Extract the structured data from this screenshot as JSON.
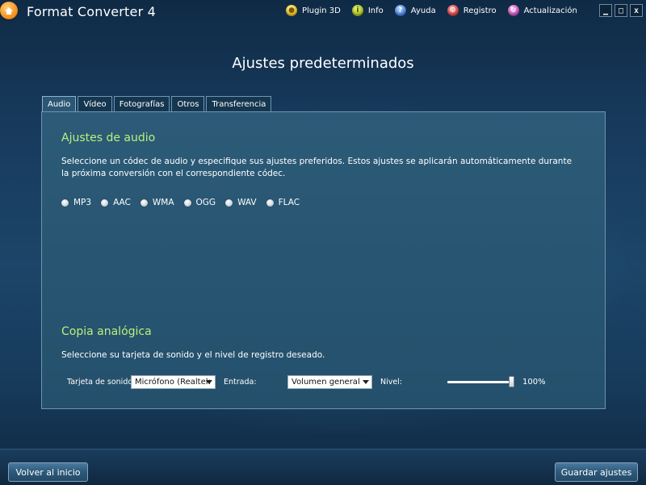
{
  "window": {
    "title": "Format Converter 4",
    "menu": [
      {
        "label": "Plugin 3D",
        "icon": "plugin-3d-icon"
      },
      {
        "label": "Info",
        "icon": "info-icon"
      },
      {
        "label": "Ayuda",
        "icon": "help-icon"
      },
      {
        "label": "Registro",
        "icon": "register-icon"
      },
      {
        "label": "Actualización",
        "icon": "update-icon"
      }
    ],
    "controls": {
      "minimize": "▁",
      "maximize": "□",
      "close": "x"
    }
  },
  "page": {
    "title": "Ajustes predeterminados"
  },
  "tabs": [
    {
      "label": "Audio",
      "active": true
    },
    {
      "label": "Vídeo",
      "active": false
    },
    {
      "label": "Fotografías",
      "active": false
    },
    {
      "label": "Otros",
      "active": false
    },
    {
      "label": "Transferencia",
      "active": false
    }
  ],
  "audio": {
    "title": "Ajustes de audio",
    "description": "Seleccione un códec de audio y especifique sus ajustes preferidos. Estos ajustes se aplicarán automáticamente durante la próxima conversión con el correspondiente códec.",
    "codecs": [
      "MP3",
      "AAC",
      "WMA",
      "OGG",
      "WAV",
      "FLAC"
    ]
  },
  "analog": {
    "title": "Copia analógica",
    "description": "Seleccione su tarjeta de sonido y el nivel de registro deseado.",
    "soundcard_label": "Tarjeta de sonido:",
    "soundcard_value": "Micrófono (Realtek",
    "input_label": "Entrada:",
    "input_value": "Volumen general",
    "level_label": "Nivel:",
    "level_value": "100%",
    "level_fraction": 1.0
  },
  "footer": {
    "back_label": "Volver al inicio",
    "save_label": "Guardar ajustes"
  },
  "colors": {
    "accent_heading": "#b9f07a",
    "panel": "#2c5b78",
    "background": "#173a5c"
  }
}
